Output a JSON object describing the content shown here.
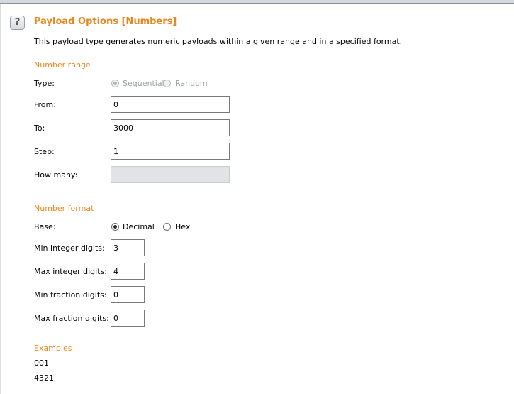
{
  "header": {
    "help_icon_glyph": "?",
    "title": "Payload Options [Numbers]",
    "description": "This payload type generates numeric payloads within a given range and in a specified format."
  },
  "number_range": {
    "section_label": "Number range",
    "type_label": "Type:",
    "type_options": [
      "Sequential",
      "Random"
    ],
    "type_selected": "Sequential",
    "type_disabled": true,
    "from_label": "From:",
    "from_value": "0",
    "to_label": "To:",
    "to_value": "3000",
    "step_label": "Step:",
    "step_value": "1",
    "how_many_label": "How many:",
    "how_many_value": ""
  },
  "number_format": {
    "section_label": "Number format",
    "base_label": "Base:",
    "base_options": [
      "Decimal",
      "Hex"
    ],
    "base_selected": "Decimal",
    "min_int_label": "Min integer digits:",
    "min_int_value": "3",
    "max_int_label": "Max integer digits:",
    "max_int_value": "4",
    "min_frac_label": "Min fraction digits:",
    "min_frac_value": "0",
    "max_frac_label": "Max fraction digits:",
    "max_frac_value": "0"
  },
  "examples": {
    "section_label": "Examples",
    "items": [
      "001",
      "4321"
    ]
  },
  "colors": {
    "accent": "#e8871e",
    "disabled_field": "#e1e3e6"
  }
}
